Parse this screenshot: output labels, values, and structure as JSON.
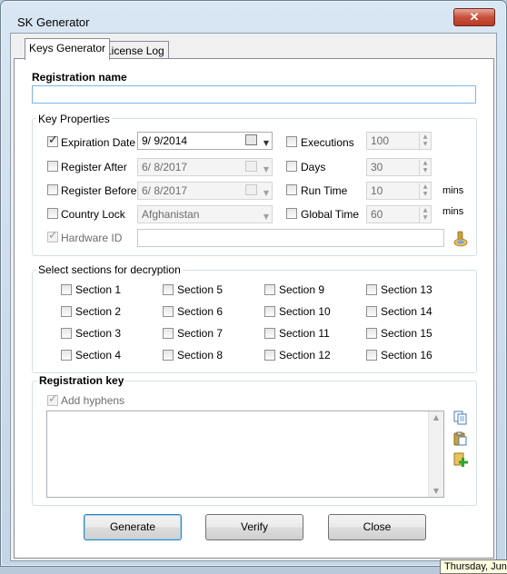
{
  "window": {
    "title": "SK Generator",
    "close_glyph": "✕"
  },
  "tabs": [
    {
      "label": "Keys Generator",
      "active": true
    },
    {
      "label": "License Log",
      "active": false
    }
  ],
  "registration_name": {
    "label": "Registration name",
    "value": ""
  },
  "key_properties": {
    "label": "Key Properties",
    "expiration_date": {
      "label": "Expiration Date",
      "checked": true,
      "value": "9/ 9/2014"
    },
    "register_after": {
      "label": "Register After",
      "checked": false,
      "value": "6/ 8/2017"
    },
    "register_before": {
      "label": "Register Before",
      "checked": false,
      "value": "6/ 8/2017"
    },
    "country_lock": {
      "label": "Country Lock",
      "checked": false,
      "value": "Afghanistan"
    },
    "hardware_id": {
      "label": "Hardware ID",
      "checked": true,
      "value": ""
    },
    "executions": {
      "label": "Executions",
      "checked": false,
      "value": "100"
    },
    "days": {
      "label": "Days",
      "checked": false,
      "value": "30"
    },
    "run_time": {
      "label": "Run Time",
      "checked": false,
      "value": "10",
      "unit": "mins"
    },
    "global_time": {
      "label": "Global Time",
      "checked": false,
      "value": "60",
      "unit": "mins"
    }
  },
  "sections": {
    "label": "Select sections for decryption",
    "items": [
      "Section 1",
      "Section 2",
      "Section 3",
      "Section 4",
      "Section 5",
      "Section 6",
      "Section 7",
      "Section 8",
      "Section 9",
      "Section 10",
      "Section 11",
      "Section 12",
      "Section 13",
      "Section 14",
      "Section 15",
      "Section 16"
    ]
  },
  "registration_key": {
    "label": "Registration key",
    "add_hyphens": {
      "label": "Add hyphens",
      "checked": true
    },
    "value": ""
  },
  "buttons": {
    "generate": "Generate",
    "verify": "Verify",
    "close": "Close"
  },
  "tooltip": "Thursday, Jun",
  "icons": {
    "hardware": "hardware-id-icon",
    "copy": "copy-icon",
    "paste": "paste-icon",
    "add": "add-icon"
  }
}
